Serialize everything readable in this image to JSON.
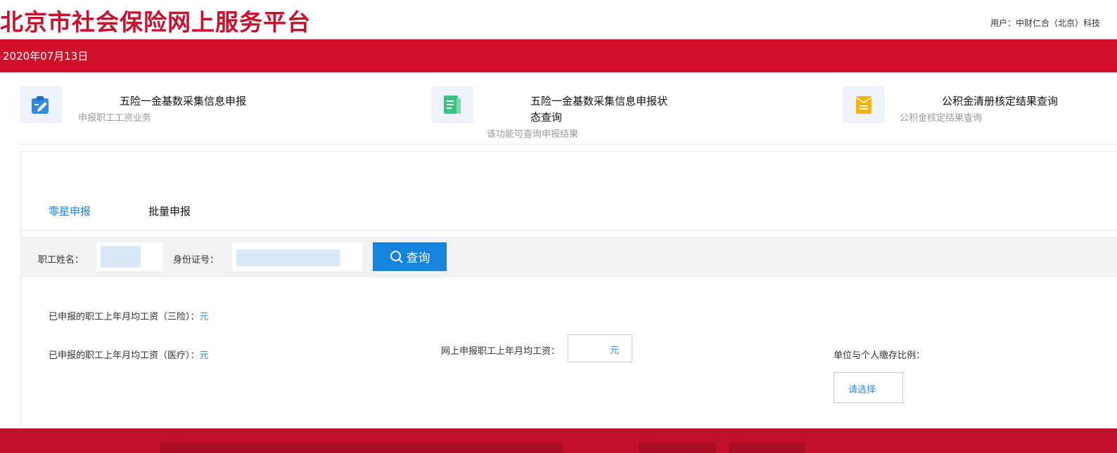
{
  "header": {
    "site_title": "北京市社会保险网上服务平台",
    "user_info": "用户：中财仁合（北京）科技",
    "date": "2020年07月13日"
  },
  "cards": [
    {
      "title": "五险一金基数采集信息申报",
      "subtitle": "申报职工工资业务",
      "icon": "clipboard-pen-icon",
      "color": "#2f8be0"
    },
    {
      "title_line1": "五险一金基数采集信息申报状",
      "title_line2": "态查询",
      "subtitle": "该功能可查询申报结果",
      "icon": "document-list-icon",
      "color": "#3cc384"
    },
    {
      "title": "公积金清册核定结果查询",
      "subtitle": "公积金核定结果查询",
      "icon": "envelope-icon",
      "color": "#f5b400"
    }
  ],
  "tabs": [
    {
      "label": "零星申报",
      "active": true
    },
    {
      "label": "批量申报",
      "active": false
    }
  ],
  "search": {
    "name_label": "职工姓名：",
    "id_label": "身份证号：",
    "query_label": "查询"
  },
  "form": {
    "three_ins_label": "已申报的职工上年月均工资（三险）：",
    "three_ins_unit": "元",
    "medical_label": "已申报的职工上年月均工资（医疗）：",
    "medical_unit": "元",
    "online_label": "网上申报职工上年月均工资：",
    "online_unit": "元",
    "ratio_label": "单位与个人缴存比例：",
    "ratio_select": "请选择"
  }
}
